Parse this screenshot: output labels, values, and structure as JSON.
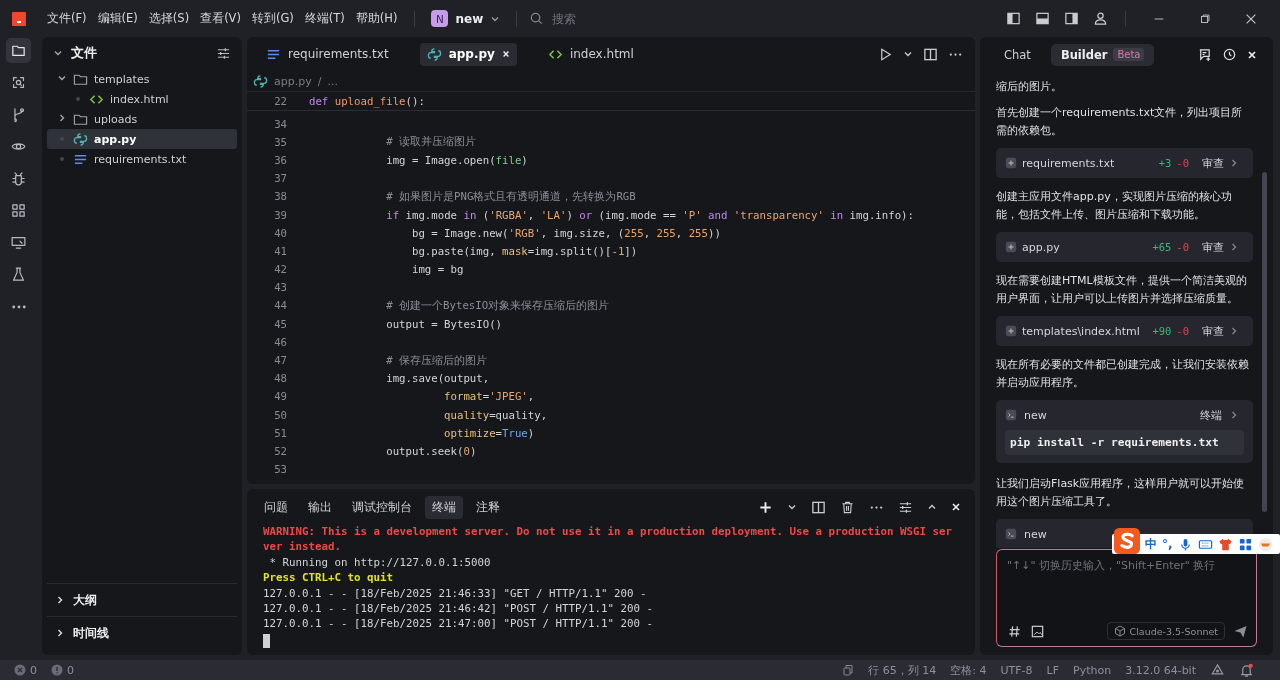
{
  "menu": [
    "文件(F)",
    "编辑(E)",
    "选择(S)",
    "查看(V)",
    "转到(G)",
    "终端(T)",
    "帮助(H)"
  ],
  "project": {
    "initial": "N",
    "name": "new"
  },
  "search": {
    "placeholder": "搜索"
  },
  "activity_bar": [
    {
      "selected": true
    },
    {
      "selected": false
    },
    {
      "selected": false
    },
    {
      "selected": false
    },
    {
      "selected": false
    },
    {
      "selected": false
    },
    {
      "selected": false
    },
    {
      "selected": false
    },
    {
      "selected": false
    }
  ],
  "sidebar": {
    "title": "文件",
    "tree": [
      {
        "name": "templates",
        "kind": "folder",
        "expanded": true,
        "selected": false,
        "children": [
          {
            "name": "index.html",
            "kind": "html",
            "selected": false
          }
        ]
      },
      {
        "name": "uploads",
        "kind": "folder",
        "expanded": false,
        "selected": false
      },
      {
        "name": "app.py",
        "kind": "python",
        "selected": true
      },
      {
        "name": "requirements.txt",
        "kind": "text",
        "selected": false
      }
    ],
    "sections": [
      "大纲",
      "时间线"
    ]
  },
  "editor": {
    "tabs": [
      {
        "label": "requirements.txt",
        "kind": "text",
        "selected": false
      },
      {
        "label": "app.py",
        "kind": "python",
        "selected": true
      },
      {
        "label": "index.html",
        "kind": "html",
        "selected": false
      }
    ],
    "breadcrumb": [
      "app.py",
      "/",
      "..."
    ],
    "sticky": {
      "number": "22",
      "tokens": [
        {
          "kind": "keyword",
          "text": "def "
        },
        {
          "kind": "function",
          "text": "upload_file"
        },
        {
          "kind": "plain",
          "text": "():"
        }
      ]
    },
    "lines": [
      {
        "number": "34"
      },
      {
        "number": "35",
        "tokens": [
          {
            "kind": "comment",
            "text": "            # 读取并压缩图片"
          }
        ]
      },
      {
        "number": "36",
        "tokens": [
          {
            "kind": "plain",
            "text": "            img = Image.open("
          },
          {
            "kind": "argument",
            "text": "file"
          },
          {
            "kind": "plain",
            "text": ")"
          }
        ]
      },
      {
        "number": "37"
      },
      {
        "number": "38",
        "tokens": [
          {
            "kind": "comment",
            "text": "            # 如果图片是PNG格式且有透明通道，先转换为RGB"
          }
        ]
      },
      {
        "number": "39",
        "tokens": [
          {
            "kind": "keyword",
            "text": "            if"
          },
          {
            "kind": "plain",
            "text": " img.mode "
          },
          {
            "kind": "keyword",
            "text": "in"
          },
          {
            "kind": "plain",
            "text": " ("
          },
          {
            "kind": "string",
            "text": "'RGBA'"
          },
          {
            "kind": "plain",
            "text": ", "
          },
          {
            "kind": "string",
            "text": "'LA'"
          },
          {
            "kind": "plain",
            "text": ") "
          },
          {
            "kind": "keyword",
            "text": "or"
          },
          {
            "kind": "plain",
            "text": " (img.mode == "
          },
          {
            "kind": "string",
            "text": "'P'"
          },
          {
            "kind": "keyword",
            "text": " and "
          },
          {
            "kind": "string",
            "text": "'transparency'"
          },
          {
            "kind": "keyword",
            "text": " in"
          },
          {
            "kind": "plain",
            "text": " img.info):"
          }
        ]
      },
      {
        "number": "40",
        "tokens": [
          {
            "kind": "plain",
            "text": "                bg = Image.new("
          },
          {
            "kind": "string",
            "text": "'RGB'"
          },
          {
            "kind": "plain",
            "text": ", img.size, ("
          },
          {
            "kind": "number",
            "text": "255"
          },
          {
            "kind": "plain",
            "text": ", "
          },
          {
            "kind": "number",
            "text": "255"
          },
          {
            "kind": "plain",
            "text": ", "
          },
          {
            "kind": "number",
            "text": "255"
          },
          {
            "kind": "plain",
            "text": "))"
          }
        ]
      },
      {
        "number": "41",
        "tokens": [
          {
            "kind": "plain",
            "text": "                bg.paste(img, "
          },
          {
            "kind": "parameter",
            "text": "mask"
          },
          {
            "kind": "plain",
            "text": "=img.split()["
          },
          {
            "kind": "number",
            "text": "-1"
          },
          {
            "kind": "plain",
            "text": "])"
          }
        ]
      },
      {
        "number": "42",
        "tokens": [
          {
            "kind": "plain",
            "text": "                img = bg"
          }
        ]
      },
      {
        "number": "43"
      },
      {
        "number": "44",
        "tokens": [
          {
            "kind": "comment",
            "text": "            # 创建一个BytesIO对象来保存压缩后的图片"
          }
        ]
      },
      {
        "number": "45",
        "tokens": [
          {
            "kind": "plain",
            "text": "            output = BytesIO()"
          }
        ]
      },
      {
        "number": "46"
      },
      {
        "number": "47",
        "tokens": [
          {
            "kind": "comment",
            "text": "            # 保存压缩后的图片"
          }
        ]
      },
      {
        "number": "48",
        "tokens": [
          {
            "kind": "plain",
            "text": "            img.save(output,"
          }
        ]
      },
      {
        "number": "49",
        "tokens": [
          {
            "kind": "parameter",
            "text": "                     format"
          },
          {
            "kind": "plain",
            "text": "="
          },
          {
            "kind": "string",
            "text": "'JPEG'"
          },
          {
            "kind": "plain",
            "text": ","
          }
        ]
      },
      {
        "number": "50",
        "tokens": [
          {
            "kind": "parameter",
            "text": "                     quality"
          },
          {
            "kind": "plain",
            "text": "=quality,"
          }
        ]
      },
      {
        "number": "51",
        "tokens": [
          {
            "kind": "parameter",
            "text": "                     optimize"
          },
          {
            "kind": "plain",
            "text": "="
          },
          {
            "kind": "constant",
            "text": "True"
          },
          {
            "kind": "plain",
            "text": ")"
          }
        ]
      },
      {
        "number": "52",
        "tokens": [
          {
            "kind": "plain",
            "text": "            output.seek("
          },
          {
            "kind": "number",
            "text": "0"
          },
          {
            "kind": "plain",
            "text": ")"
          }
        ]
      },
      {
        "number": "53"
      }
    ]
  },
  "panel": {
    "tabs": [
      {
        "label": "问题",
        "selected": false
      },
      {
        "label": "输出",
        "selected": false
      },
      {
        "label": "调试控制台",
        "selected": false
      },
      {
        "label": "终端",
        "selected": true
      },
      {
        "label": "注释",
        "selected": false
      }
    ],
    "lines": [
      {
        "kind": "warning",
        "text": "WARNING: This is a development server. Do not use it in a production deployment. Use a production WSGI ser"
      },
      {
        "kind": "warning",
        "text": "ver instead."
      },
      {
        "kind": "plain",
        "text": " * Running on http://127.0.0.1:5000"
      },
      {
        "kind": "notice",
        "text": "Press CTRL+C to quit"
      },
      {
        "kind": "plain",
        "text": "127.0.0.1 - - [18/Feb/2025 21:46:33] \"GET / HTTP/1.1\" 200 -"
      },
      {
        "kind": "plain",
        "text": "127.0.0.1 - - [18/Feb/2025 21:46:42] \"POST / HTTP/1.1\" 200 -"
      },
      {
        "kind": "plain",
        "text": "127.0.0.1 - - [18/Feb/2025 21:47:00] \"POST / HTTP/1.1\" 200 -"
      }
    ]
  },
  "chat": {
    "tabs": [
      {
        "label": "Chat",
        "selected": false
      },
      {
        "label": "Builder",
        "selected": true,
        "badge": "Beta"
      }
    ],
    "messages": [
      {
        "kind": "text",
        "text": "缩后的图片。"
      },
      {
        "kind": "text",
        "text": "首先创建一个requirements.txt文件，列出项目所需的依赖包。"
      },
      {
        "kind": "file",
        "name": "requirements.txt",
        "added": "+3",
        "removed": "-0",
        "action": "审查"
      },
      {
        "kind": "text",
        "text": "创建主应用文件app.py，实现图片压缩的核心功能，包括文件上传、图片压缩和下载功能。"
      },
      {
        "kind": "file",
        "name": "app.py",
        "added": "+65",
        "removed": "-0",
        "action": "审查"
      },
      {
        "kind": "text",
        "text": "现在需要创建HTML模板文件，提供一个简洁美观的用户界面，让用户可以上传图片并选择压缩质量。"
      },
      {
        "kind": "file",
        "name": "templates\\index.html",
        "added": "+90",
        "removed": "-0",
        "action": "审查"
      },
      {
        "kind": "text",
        "text": "现在所有必要的文件都已创建完成，让我们安装依赖并启动应用程序。"
      },
      {
        "kind": "terminal",
        "name": "new",
        "action": "终端",
        "command": "pip install -r requirements.txt"
      },
      {
        "kind": "text",
        "text": "让我们启动Flask应用程序，这样用户就可以开始使用这个图片压缩工具了。"
      },
      {
        "kind": "terminal",
        "name": "new"
      }
    ],
    "input": {
      "placeholder": "\"↑↓\" 切换历史输入，\"Shift+Enter\" 换行",
      "model": "Claude-3.5-Sonnet"
    }
  },
  "ime_bar": {
    "mode": "中",
    "punctuation": "°,"
  },
  "status_bar": {
    "errors": "0",
    "warnings": "0",
    "items": [
      "行 65，列 14",
      "空格: 4",
      "UTF-8",
      "LF",
      "Python",
      "3.12.0 64-bit"
    ]
  }
}
